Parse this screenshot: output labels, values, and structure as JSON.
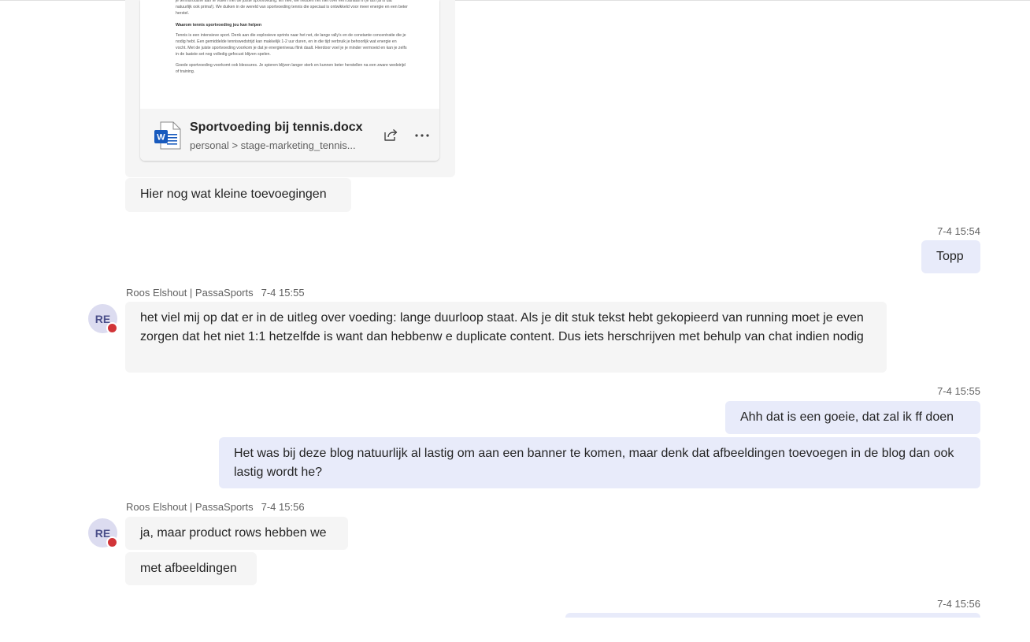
{
  "attachment": {
    "file_name": "Sportvoeding bij tennis.docx",
    "path": "personal > stage-marketing_tennis...",
    "file_icon": "word-doc-icon",
    "preview": {
      "p1": "je tennisroutine aan te vullen met de juiste sportvoeding. En nee, we hebben het niet over een banaan in je tas (al is dat natuurlijk ook prima!). We duiken in de wereld van sportvoeding tennis die speciaal is ontwikkeld voor meer energie en een beter herstel.",
      "heading": "Waarom tennis sportvoeding jou kan helpen",
      "p2": "Tennis is een intensieve sport. Denk aan die explosieve sprints naar het net, de lange rally's en de constante concentratie die je nodig hebt. Een gemiddelde tenniswedstrijd kan makkelijk 1-2 uur duren, en in die tijd verbruik je behoorlijk wat energie en vocht. Met de juiste sportvoeding voorkom je dat je energieniveau flink daalt. Hierdoor voel je je minder vermoeid en kan je zelfs in de laatste set nog volledig gefocust blijven spelen.",
      "p3": "Goede sportvoeding voorkomt ook blessures. Je spieren blijven langer sterk en kunnen beter herstellen na een zware wedstrijd of training."
    }
  },
  "messages": {
    "m1": "Hier nog wat kleine toevoegingen",
    "t2": "7-4 15:54",
    "m2": "Topp",
    "sender": "Roos Elshout | PassaSports",
    "avatar_initials": "RE",
    "t3": "7-4 15:55",
    "m3": "het viel mij op dat er in de uitleg over voeding: lange duurloop staat. Als je dit stuk tekst hebt gekopieerd van running moet je even zorgen dat het niet 1:1 hetzelfde is want dan hebbenw e duplicate content. Dus iets herschrijven met behulp van chat indien nodig",
    "t4": "7-4 15:55",
    "m4": "Ahh dat is een goeie, dat zal ik ff doen",
    "m5": "Het was bij deze blog natuurlijk al lastig om aan een banner te komen, maar denk dat afbeeldingen toevoegen in de blog dan ook lastig wordt he?",
    "t6": "7-4 15:56",
    "m6": "ja, maar product rows hebben we",
    "m7": "met afbeeldingen",
    "t8": "7-4 15:56"
  },
  "colors": {
    "incoming_bubble": "#f5f5f5",
    "outgoing_bubble": "#e8ebfa",
    "presence_busy": "#d13438"
  }
}
